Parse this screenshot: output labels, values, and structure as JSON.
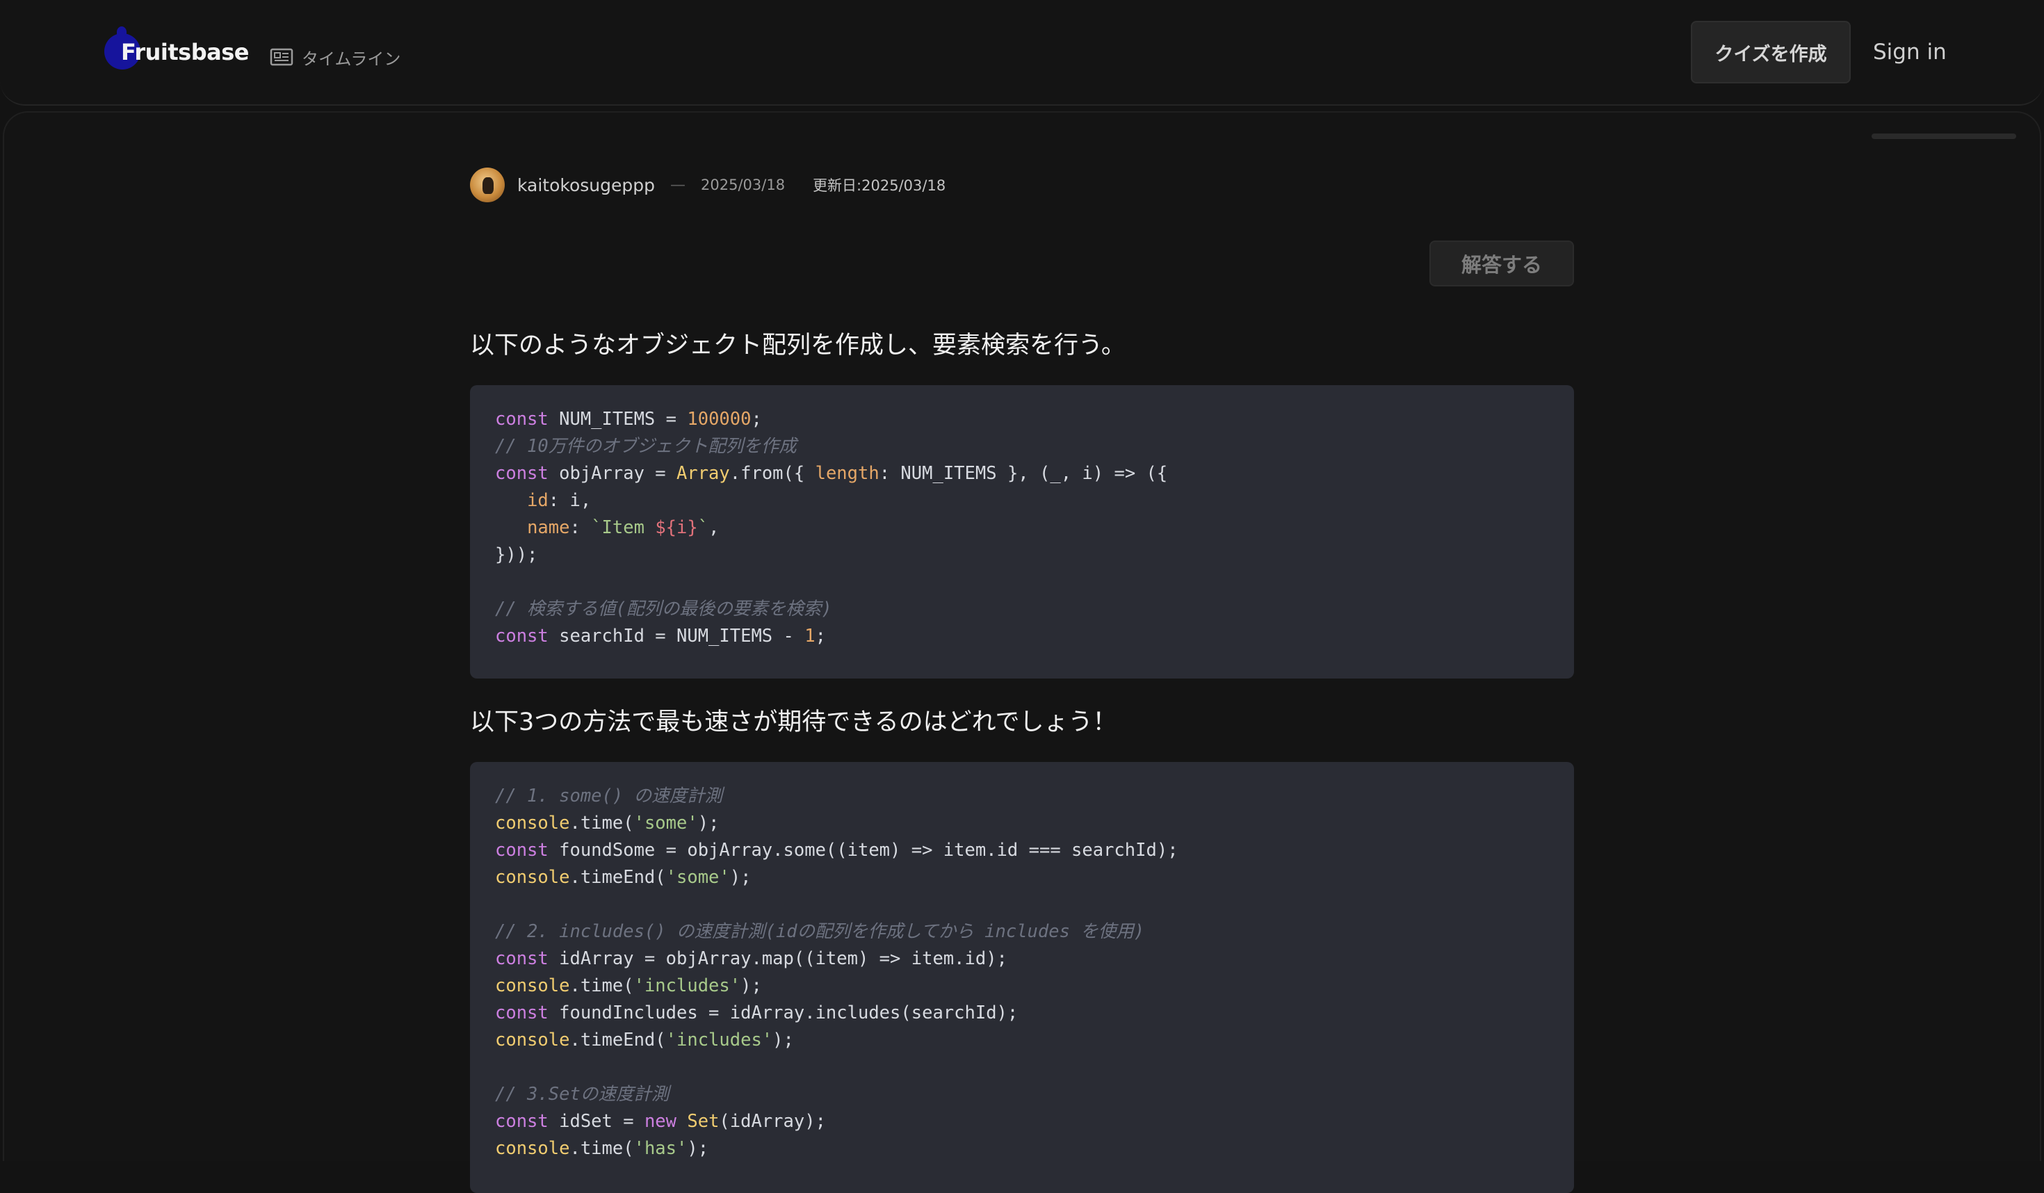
{
  "header": {
    "logo_text": "Fruitsbase",
    "nav_timeline_label": "タイムライン",
    "create_quiz_label": "クイズを作成",
    "signin_label": "Sign in"
  },
  "meta": {
    "author": "kaitokosugeppp",
    "separator": "—",
    "date": "2025/03/18",
    "updated": "更新日:2025/03/18"
  },
  "answer_button_label": "解答する",
  "content": {
    "paragraph1": "以下のようなオブジェクト配列を作成し、要素検索を行う。",
    "paragraph2": "以下3つの方法で最も速さが期待できるのはどれでしょう！"
  },
  "code1": [
    [
      [
        "kw",
        "const"
      ],
      [
        "t",
        " NUM_ITEMS = "
      ],
      [
        "num",
        "100000"
      ],
      [
        "t",
        ";"
      ]
    ],
    [
      [
        "cm",
        "// 10万件のオブジェクト配列を作成"
      ]
    ],
    [
      [
        "kw",
        "const"
      ],
      [
        "t",
        " objArray = "
      ],
      [
        "cls",
        "Array"
      ],
      [
        "t",
        ".from({ "
      ],
      [
        "prop",
        "length"
      ],
      [
        "t",
        ": NUM_ITEMS }, (_, i) => ({"
      ]
    ],
    [
      [
        "t",
        "   "
      ],
      [
        "prop",
        "id"
      ],
      [
        "t",
        ": i,"
      ]
    ],
    [
      [
        "t",
        "   "
      ],
      [
        "prop",
        "name"
      ],
      [
        "t",
        ": "
      ],
      [
        "str",
        "`Item "
      ],
      [
        "tpl",
        "${i}"
      ],
      [
        "str",
        "`"
      ],
      [
        "t",
        ","
      ]
    ],
    [
      [
        "t",
        "}));"
      ]
    ],
    [],
    [
      [
        "cm",
        "// 検索する値(配列の最後の要素を検索)"
      ]
    ],
    [
      [
        "kw",
        "const"
      ],
      [
        "t",
        " searchId = NUM_ITEMS - "
      ],
      [
        "num",
        "1"
      ],
      [
        "t",
        ";"
      ]
    ]
  ],
  "code2": [
    [
      [
        "cm",
        "// 1. some() の速度計測"
      ]
    ],
    [
      [
        "cls",
        "console"
      ],
      [
        "t",
        ".time("
      ],
      [
        "str",
        "'some'"
      ],
      [
        "t",
        ");"
      ]
    ],
    [
      [
        "kw",
        "const"
      ],
      [
        "t",
        " foundSome = objArray.some((item) => item.id === searchId);"
      ]
    ],
    [
      [
        "cls",
        "console"
      ],
      [
        "t",
        ".timeEnd("
      ],
      [
        "str",
        "'some'"
      ],
      [
        "t",
        ");"
      ]
    ],
    [],
    [
      [
        "cm",
        "// 2. includes() の速度計測(idの配列を作成してから includes を使用)"
      ]
    ],
    [
      [
        "kw",
        "const"
      ],
      [
        "t",
        " idArray = objArray.map((item) => item.id);"
      ]
    ],
    [
      [
        "cls",
        "console"
      ],
      [
        "t",
        ".time("
      ],
      [
        "str",
        "'includes'"
      ],
      [
        "t",
        ");"
      ]
    ],
    [
      [
        "kw",
        "const"
      ],
      [
        "t",
        " foundIncludes = idArray.includes(searchId);"
      ]
    ],
    [
      [
        "cls",
        "console"
      ],
      [
        "t",
        ".timeEnd("
      ],
      [
        "str",
        "'includes'"
      ],
      [
        "t",
        ");"
      ]
    ],
    [],
    [
      [
        "cm",
        "// 3.Setの速度計測"
      ]
    ],
    [
      [
        "kw",
        "const"
      ],
      [
        "t",
        " idSet = "
      ],
      [
        "kw",
        "new"
      ],
      [
        "t",
        " "
      ],
      [
        "cls",
        "Set"
      ],
      [
        "t",
        "(idArray);"
      ]
    ],
    [
      [
        "cls",
        "console"
      ],
      [
        "t",
        ".time("
      ],
      [
        "str",
        "'has'"
      ],
      [
        "t",
        ");"
      ]
    ]
  ]
}
